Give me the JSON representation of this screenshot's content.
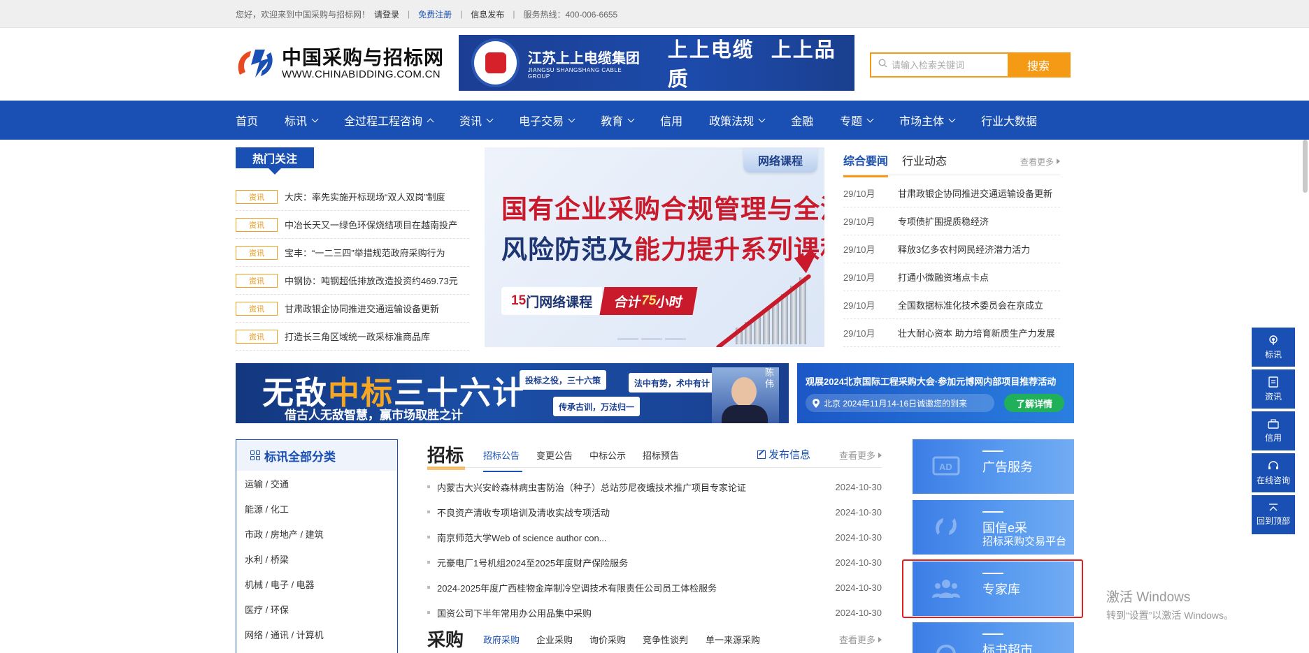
{
  "topbar": {
    "welcome": "您好，欢迎来到中国采购与招标网！",
    "login": "请登录",
    "register": "免费注册",
    "publish": "信息发布",
    "hotline": "服务热线：400-006-6655"
  },
  "logo": {
    "cn": "中国采购与招标网",
    "en": "WWW.CHINABIDDING.COM.CN"
  },
  "ad_banner": {
    "company_cn": "江苏上上电缆集团",
    "company_en": "JIANGSU SHANGSHANG CABLE GROUP",
    "slogan": "上上电缆 上上品质"
  },
  "search": {
    "placeholder": "请输入检索关键词",
    "button": "搜索"
  },
  "nav": {
    "items": [
      {
        "label": "首页"
      },
      {
        "label": "标讯"
      },
      {
        "label": "全过程工程咨询"
      },
      {
        "label": "资讯"
      },
      {
        "label": "电子交易"
      },
      {
        "label": "教育"
      },
      {
        "label": "信用"
      },
      {
        "label": "政策法规"
      },
      {
        "label": "金融"
      },
      {
        "label": "专题"
      },
      {
        "label": "市场主体"
      },
      {
        "label": "行业大数据"
      }
    ]
  },
  "hot": {
    "title": "热门关注",
    "items": [
      {
        "tag": "资讯",
        "title": "大庆：率先实施开标现场“双人双岗”制度"
      },
      {
        "tag": "资讯",
        "title": "中冶长天又一绿色环保烧结项目在越南投产"
      },
      {
        "tag": "资讯",
        "title": "宝丰：“一二三四”举措规范政府采购行为"
      },
      {
        "tag": "资讯",
        "title": "中钢协：吨钢超低排放改造投资约469.73元"
      },
      {
        "tag": "资讯",
        "title": "甘肃政银企协同推进交通运输设备更新"
      },
      {
        "tag": "资讯",
        "title": "打造长三角区域统一政采标准商品库"
      }
    ]
  },
  "course": {
    "badge": "网络课程",
    "line1": "国有企业采购合规管理与全流程",
    "line2a": "风险防范及",
    "line2b": "能力提升系列课程",
    "pill_a1": "15",
    "pill_a2": "门网络课程",
    "pill_b1": "合计",
    "pill_b2": "75",
    "pill_b3": "小时"
  },
  "news": {
    "tab_active": "综合要闻",
    "tab_other": "行业动态",
    "more": "查看更多",
    "items": [
      {
        "date": "29/10月",
        "title": "甘肃政银企协同推进交通运输设备更新"
      },
      {
        "date": "29/10月",
        "title": "专项债扩围提质稳经济"
      },
      {
        "date": "29/10月",
        "title": "释放3亿多农村网民经济潜力活力"
      },
      {
        "date": "29/10月",
        "title": "打通小微融资堵点卡点"
      },
      {
        "date": "29/10月",
        "title": "全国数据标准化技术委员会在京成立"
      },
      {
        "date": "29/10月",
        "title": "壮大耐心资本 助力培育新质生产力发展"
      }
    ]
  },
  "banner2": {
    "h1": "无敌",
    "h2": "中标",
    "h3": "三十六计",
    "sub": "借古人无敌智慧，赢市场取胜之计",
    "chip1": "投标之役，三十六策",
    "chip2": "法中有势，术中有计",
    "chip3": "传承古训，万法归一",
    "person": "陈伟"
  },
  "banner3": {
    "title": "观展2024北京国际工程采购大会·参加元博网内部项目推荐活动",
    "sub": "北京 2024年11月14-16日诚邀您的到来",
    "button": "了解详情"
  },
  "category": {
    "title": "标讯全部分类",
    "items": [
      "运输 / 交通",
      "能源 / 化工",
      "市政 / 房地产 / 建筑",
      "水利 / 桥梁",
      "机械 / 电子 / 电器",
      "医疗 / 环保",
      "网络 / 通讯 / 计算机"
    ]
  },
  "tender": {
    "title": "招标",
    "tabs": [
      "招标公告",
      "变更公告",
      "中标公示",
      "招标预告"
    ],
    "publish": "发布信息",
    "more": "查看更多",
    "items": [
      {
        "title": "内蒙古大兴安岭森林病虫害防治（种子）总站莎尼夜蛾技术推广项目专家论证",
        "date": "2024-10-30"
      },
      {
        "title": "不良资产清收专项培训及清收实战专项活动",
        "date": "2024-10-30"
      },
      {
        "title": "南京师范大学Web of science author con...",
        "date": "2024-10-30"
      },
      {
        "title": "元豪电厂1号机组2024至2025年度财产保险服务",
        "date": "2024-10-30"
      },
      {
        "title": "2024-2025年度广西桂物金岸制冷空调技术有限责任公司员工体检服务",
        "date": "2024-10-30"
      },
      {
        "title": "国资公司下半年常用办公用品集中采购",
        "date": "2024-10-30"
      }
    ]
  },
  "purchase": {
    "title": "采购",
    "tabs": [
      "政府采购",
      "企业采购",
      "询价采购",
      "竞争性谈判",
      "单一来源采购"
    ],
    "more": "查看更多"
  },
  "tiles": [
    {
      "label": "广告服务",
      "sub": ""
    },
    {
      "label": "国信e采",
      "sub": "招标采购交易平台"
    },
    {
      "label": "专家库",
      "sub": ""
    },
    {
      "label": "标书超市",
      "sub": ""
    }
  ],
  "float": [
    "标讯",
    "资讯",
    "信用",
    "在线咨询",
    "回到顶部"
  ],
  "watermark": {
    "line1": "激活 Windows",
    "line2": "转到“设置”以激活 Windows。"
  },
  "colors": {
    "brand_blue": "#1a50b3",
    "accent_orange": "#f59a14",
    "highlight_red": "#e02020"
  }
}
